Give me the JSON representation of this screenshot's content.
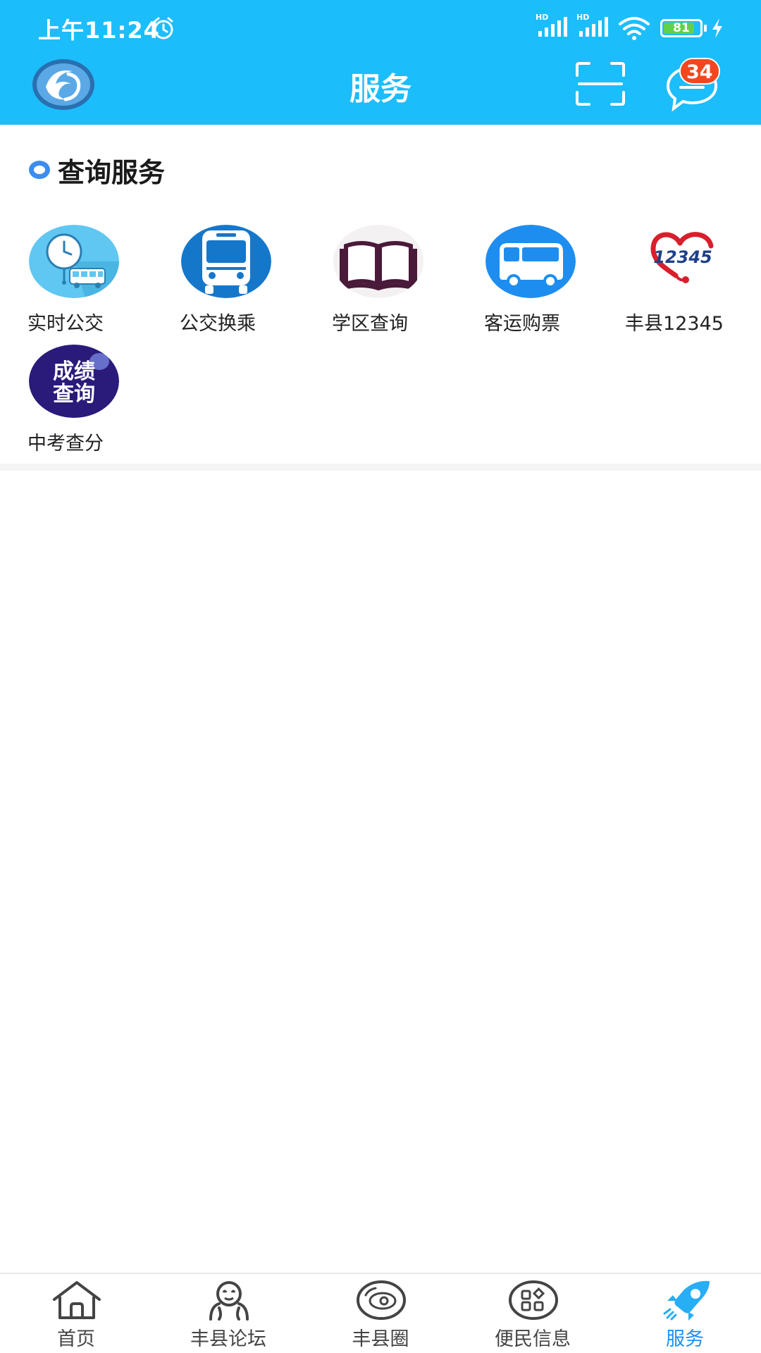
{
  "status_bar": {
    "time": "上午11:24",
    "battery_level": "81",
    "network_label": "HD"
  },
  "app_bar": {
    "title": "服务",
    "message_badge_count": "34"
  },
  "section": {
    "title": "查询服务",
    "items": [
      {
        "label": "实时公交",
        "icon": "bus-clock-icon"
      },
      {
        "label": "公交换乘",
        "icon": "bus-icon"
      },
      {
        "label": "学区查询",
        "icon": "book-icon"
      },
      {
        "label": "客运购票",
        "icon": "coach-icon"
      },
      {
        "label": "丰县12345",
        "icon": "hotline-12345-icon"
      },
      {
        "label": "中考查分",
        "icon": "score-query-icon",
        "icon_text": [
          "成绩",
          "查询"
        ]
      }
    ],
    "hotline_icon_text": "12345"
  },
  "bottom_nav": {
    "items": [
      {
        "label": "首页",
        "icon": "home-icon",
        "active": false
      },
      {
        "label": "丰县论坛",
        "icon": "forum-icon",
        "active": false
      },
      {
        "label": "丰县圈",
        "icon": "circle-icon",
        "active": false
      },
      {
        "label": "便民信息",
        "icon": "apps-icon",
        "active": false
      },
      {
        "label": "服务",
        "icon": "rocket-icon",
        "active": true
      }
    ]
  },
  "colors": {
    "header": "#1cbdfb",
    "badge": "#f4461e",
    "active_nav": "#1d8ef0",
    "section_dot": "#3d8df0"
  }
}
